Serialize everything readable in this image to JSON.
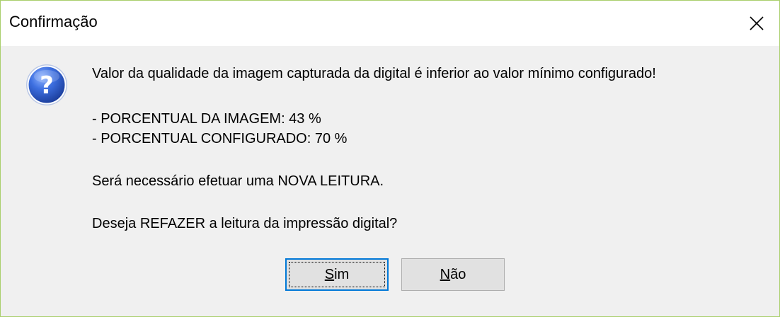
{
  "window": {
    "title": "Confirmação",
    "close_icon": "close-icon"
  },
  "dialog": {
    "icon": "question-icon",
    "lines": {
      "warning": "Valor da qualidade da imagem capturada da digital é inferior ao valor mínimo configurado!",
      "image_percent": "- PORCENTUAL DA IMAGEM: 43 %",
      "config_percent": "- PORCENTUAL CONFIGURADO: 70 %",
      "new_read": "Será necessário efetuar uma NOVA LEITURA.",
      "question": "Deseja REFAZER a leitura da impressão digital?"
    }
  },
  "buttons": {
    "yes": {
      "mnemonic": "S",
      "rest": "im"
    },
    "no": {
      "mnemonic": "N",
      "rest": "ão"
    }
  },
  "colors": {
    "window_border": "#a9cf6c",
    "button_focus_border": "#0078d7",
    "question_icon": "#2a56c6"
  }
}
